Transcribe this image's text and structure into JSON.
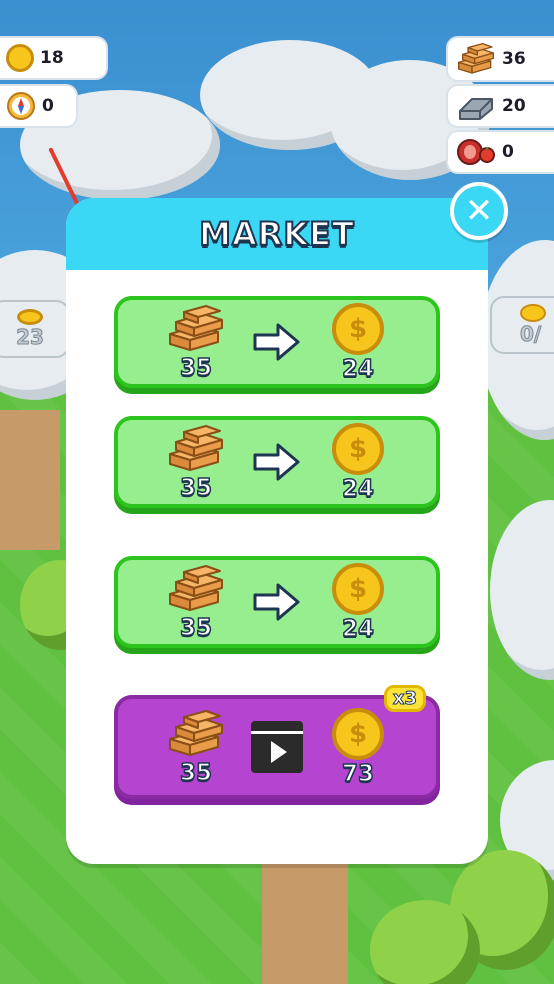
{
  "hud": {
    "coins": "18",
    "compass": "0",
    "wood": "36",
    "iron": "20",
    "food": "0"
  },
  "world_labels": {
    "left_cost": "23",
    "right_cost": "0/"
  },
  "market": {
    "title": "MARKET",
    "trades": [
      {
        "give": "35",
        "get": "24"
      },
      {
        "give": "35",
        "get": "24"
      },
      {
        "give": "35",
        "get": "24"
      }
    ],
    "ad_trade": {
      "give": "35",
      "get": "73",
      "multiplier": "x3"
    }
  },
  "icons": {
    "coin": "gold-coin-icon",
    "compass": "compass-icon",
    "wood": "wood-planks-icon",
    "iron": "iron-ingot-icon",
    "food": "meat-icon",
    "arrow": "right-arrow-icon",
    "video": "video-ad-icon",
    "close": "close-icon"
  },
  "colors": {
    "header": "#3ad8f4",
    "trade_green": "#97ee8e",
    "trade_green_border": "#2bc51e",
    "trade_purple": "#b545d1",
    "badge": "#fbe33a"
  }
}
